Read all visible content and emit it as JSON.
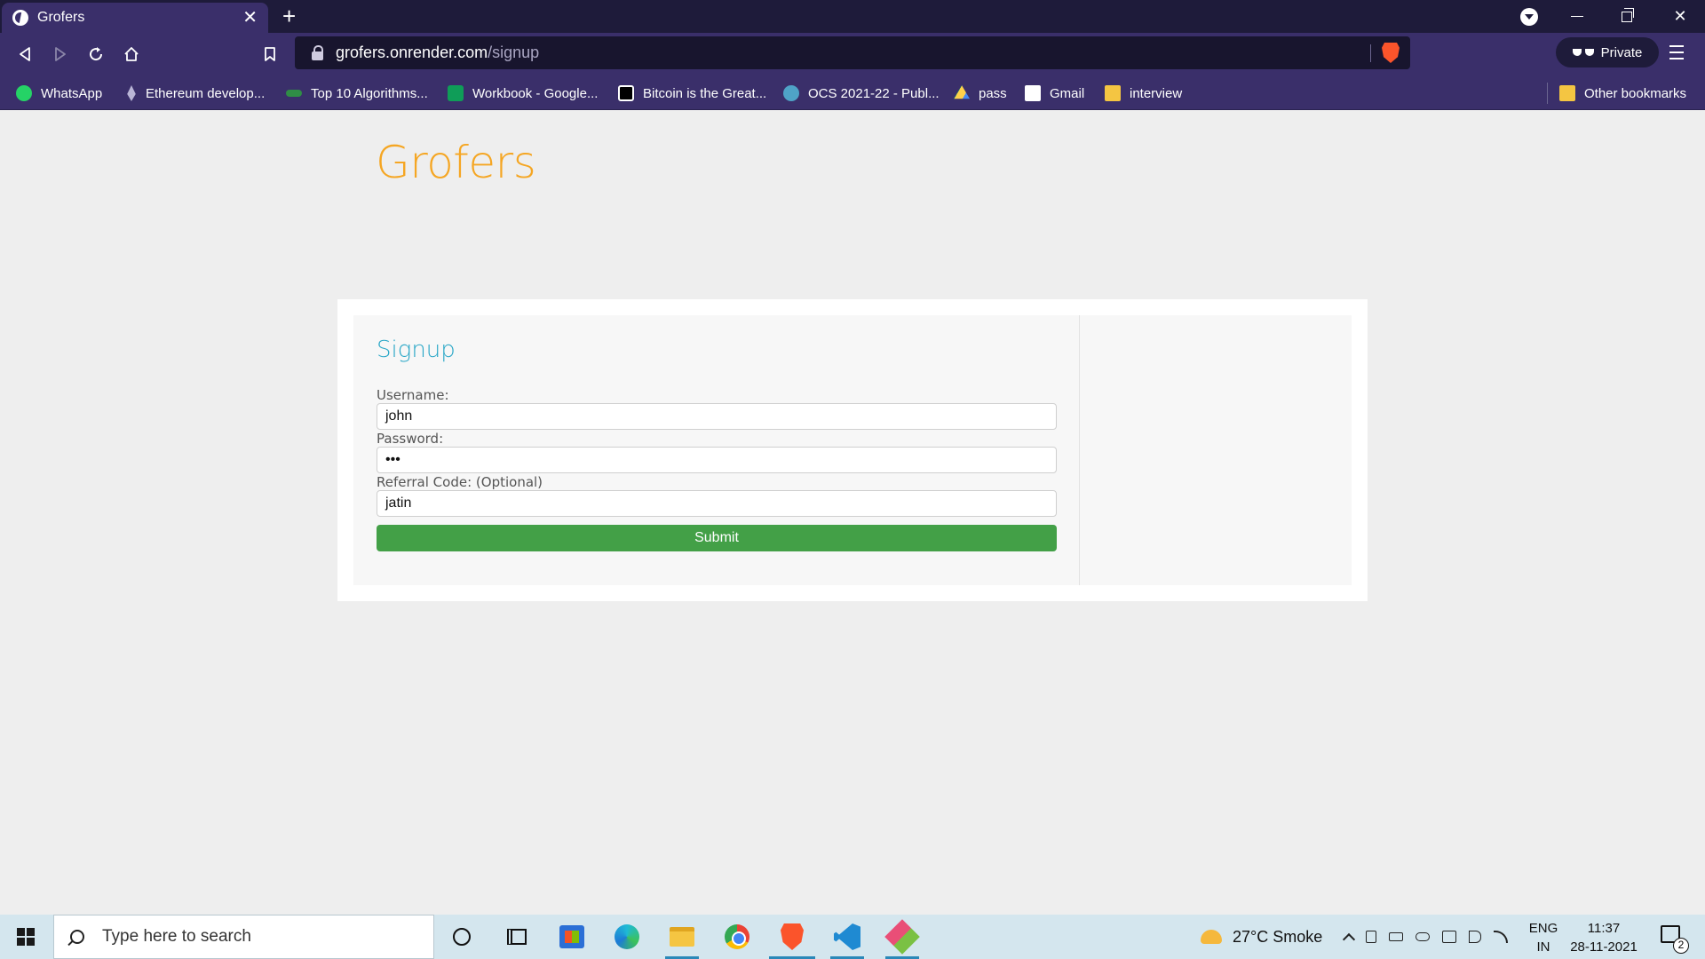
{
  "browser": {
    "tab": {
      "title": "Grofers"
    },
    "url": {
      "host": "grofers.onrender.com",
      "path": "/signup"
    },
    "private_label": "Private",
    "bookmarks": [
      {
        "label": "WhatsApp",
        "icon": "whatsapp-icon"
      },
      {
        "label": "Ethereum develop...",
        "icon": "ethereum-icon"
      },
      {
        "label": "Top 10 Algorithms...",
        "icon": "geeksforgeeks-icon"
      },
      {
        "label": "Workbook - Google...",
        "icon": "google-sheets-icon"
      },
      {
        "label": "Bitcoin is the Great...",
        "icon": "medium-icon"
      },
      {
        "label": "OCS 2021-22 - Publ...",
        "icon": "ocs-icon"
      },
      {
        "label": "pass",
        "icon": "google-drive-icon"
      },
      {
        "label": "Gmail",
        "icon": "gmail-icon"
      },
      {
        "label": "interview",
        "icon": "folder-icon"
      }
    ],
    "other_bookmarks": "Other bookmarks"
  },
  "page": {
    "brand": "Grofers",
    "signup": {
      "title": "Signup",
      "username_label": "Username:",
      "username_value": "john",
      "password_label": "Password:",
      "password_value": "•••",
      "referral_label": "Referral Code: (Optional)",
      "referral_value": "jatin",
      "submit_label": "Submit"
    }
  },
  "taskbar": {
    "search_placeholder": "Type here to search",
    "weather": "27°C  Smoke",
    "lang_top": "ENG",
    "lang_bottom": "IN",
    "time": "11:37",
    "date": "28-11-2021",
    "notification_count": "2"
  },
  "colors": {
    "brand": "#f5a623",
    "signup_title": "#2aa7c7",
    "submit": "#43a047",
    "browser_chrome": "#3a2f6a"
  }
}
